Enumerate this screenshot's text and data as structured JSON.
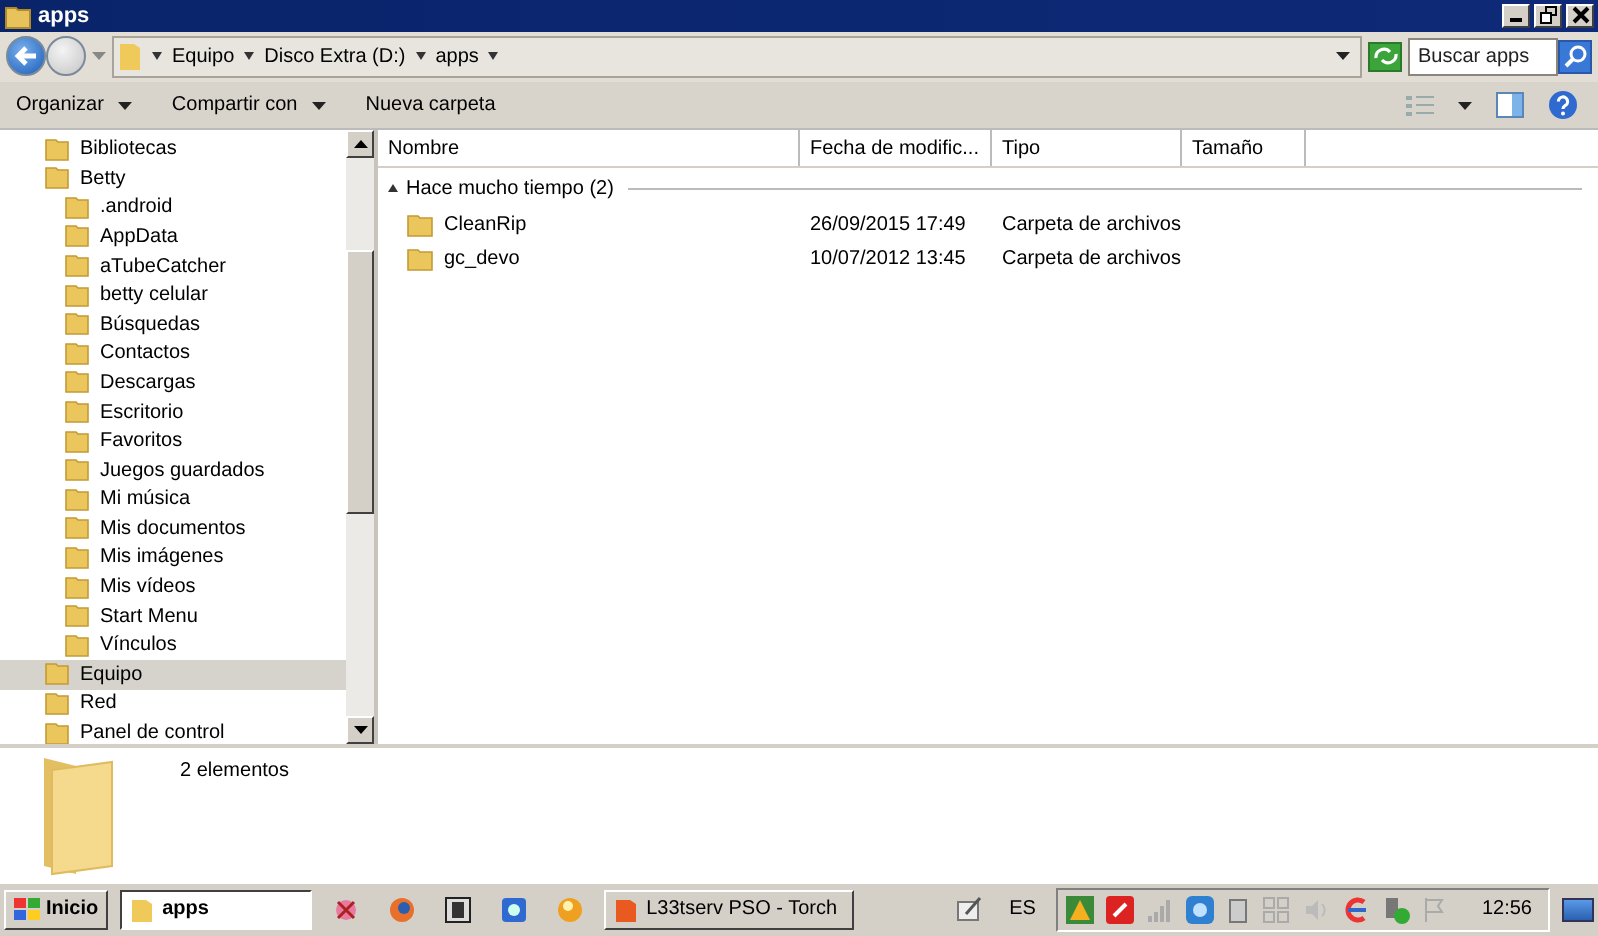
{
  "window": {
    "title": "apps"
  },
  "address": {
    "crumbs": [
      "Equipo",
      "Disco Extra (D:)",
      "apps"
    ]
  },
  "search": {
    "placeholder": "Buscar apps"
  },
  "toolbar": {
    "buttons": [
      {
        "label": "Organizar",
        "dropdown": true
      },
      {
        "label": "Compartir con",
        "dropdown": true
      },
      {
        "label": "Nueva carpeta",
        "dropdown": false
      }
    ]
  },
  "sidebar": {
    "items": [
      {
        "label": "Bibliotecas",
        "selected": false
      },
      {
        "label": "Betty",
        "selected": false,
        "children": [
          {
            "label": ".android",
            "selected": false
          },
          {
            "label": "AppData",
            "selected": false
          },
          {
            "label": "aTubeCatcher",
            "selected": false
          },
          {
            "label": "betty celular",
            "selected": false
          },
          {
            "label": "Búsquedas",
            "selected": false
          },
          {
            "label": "Contactos",
            "selected": false
          },
          {
            "label": "Descargas",
            "selected": false
          },
          {
            "label": "Escritorio",
            "selected": false
          },
          {
            "label": "Favoritos",
            "selected": false
          },
          {
            "label": "Juegos guardados",
            "selected": false
          },
          {
            "label": "Mi música",
            "selected": false
          },
          {
            "label": "Mis documentos",
            "selected": false
          },
          {
            "label": "Mis imágenes",
            "selected": false
          },
          {
            "label": "Mis vídeos",
            "selected": false
          },
          {
            "label": "Start Menu",
            "selected": false
          },
          {
            "label": "Vínculos",
            "selected": false
          }
        ]
      },
      {
        "label": "Equipo",
        "selected": true
      },
      {
        "label": "Red",
        "selected": false
      },
      {
        "label": "Panel de control",
        "selected": false
      }
    ]
  },
  "table": {
    "columns": [
      "Nombre",
      "Fecha de modific...",
      "Tipo",
      "Tamaño"
    ],
    "group": "Hace mucho tiempo (2)",
    "rows": [
      {
        "name": "CleanRip",
        "date": "26/09/2015 17:49",
        "type": "Carpeta de archivos"
      },
      {
        "name": "gc_devo",
        "date": "10/07/2012 13:45",
        "type": "Carpeta de archivos"
      }
    ]
  },
  "details": {
    "count": "2 elementos"
  },
  "taskbar": {
    "start": "Inicio",
    "tasks": [
      {
        "label": "apps",
        "selected": true
      },
      {
        "label": "L33tserv PSO - Torch",
        "selected": false
      }
    ],
    "language": "ES",
    "clock": "12:56"
  }
}
